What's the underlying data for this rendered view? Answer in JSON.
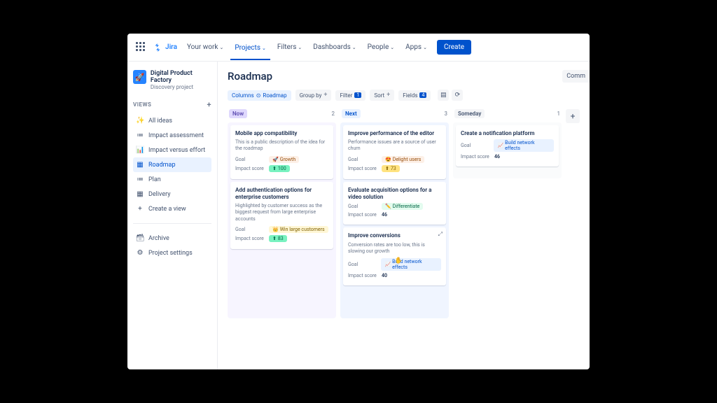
{
  "topbar": {
    "logo": "Jira",
    "nav": [
      "Your work",
      "Projects",
      "Filters",
      "Dashboards",
      "People",
      "Apps"
    ],
    "activeNav": 1,
    "create": "Create"
  },
  "sidebar": {
    "project": {
      "name": "Digital Product Factory",
      "subtitle": "Discovery project",
      "emoji": "🚀"
    },
    "viewsLabel": "VIEWS",
    "views": [
      {
        "icon": "✨",
        "label": "All ideas"
      },
      {
        "icon": "≔",
        "label": "Impact assessment"
      },
      {
        "icon": "📊",
        "label": "Impact versus effort"
      },
      {
        "icon": "▦",
        "label": "Roadmap"
      },
      {
        "icon": "≔",
        "label": "Plan"
      },
      {
        "icon": "▦",
        "label": "Delivery"
      }
    ],
    "createView": "Create a view",
    "archive": "Archive",
    "settings": "Project settings"
  },
  "main": {
    "title": "Roadmap",
    "commentBtn": "Comm",
    "filters": {
      "columns": {
        "label": "Columns",
        "value": "Roadmap"
      },
      "groupBy": "Group by",
      "filter": {
        "label": "Filter",
        "count": "1"
      },
      "sort": "Sort",
      "fields": {
        "label": "Fields",
        "count": "4"
      }
    }
  },
  "board": {
    "columns": [
      {
        "title": "Now",
        "count": "2",
        "styleClass": "col-now",
        "bodyClass": "",
        "cards": [
          {
            "title": "Mobile app compatibility",
            "desc": "This is a public description of the idea for the roadmap",
            "goal": {
              "label": "Growth",
              "icon": "🚀",
              "cls": "goal-growth"
            },
            "score": {
              "val": "100",
              "cls": ""
            },
            "showScoreTag": true
          },
          {
            "title": "Add authentication options for enterprise customers",
            "desc": "Highlighted by customer success as the biggest request from large enterprise accounts",
            "goal": {
              "label": "Win large customers",
              "icon": "👑",
              "cls": "goal-win"
            },
            "score": {
              "val": "83",
              "cls": ""
            },
            "showScoreTag": true
          }
        ]
      },
      {
        "title": "Next",
        "count": "3",
        "styleClass": "col-next",
        "bodyClass": "next",
        "cards": [
          {
            "title": "Improve performance of the editor",
            "desc": "Performance issues are a source of user churn",
            "goal": {
              "label": "Delight users",
              "icon": "😍",
              "cls": "goal-delight"
            },
            "score": {
              "val": "73",
              "cls": "med"
            },
            "showScoreTag": true
          },
          {
            "title": "Evaluate acquisition options for a video solution",
            "desc": "",
            "goal": {
              "label": "Differentiate",
              "icon": "✏️",
              "cls": "goal-diff"
            },
            "scorePlain": "46"
          },
          {
            "title": "Improve conversions",
            "desc": "Conversion rates are too low, this is slowing our growth",
            "goal": {
              "label": "Build network effects",
              "icon": "📈",
              "cls": "goal-network"
            },
            "scorePlain": "40",
            "expand": true,
            "cursor": true
          }
        ]
      },
      {
        "title": "Someday",
        "count": "1",
        "styleClass": "col-some",
        "bodyClass": "some",
        "cards": [
          {
            "title": "Create a notification platform",
            "desc": "",
            "goal": {
              "label": "Build network effects",
              "icon": "📈",
              "cls": "goal-network"
            },
            "scorePlain": "46"
          }
        ]
      }
    ]
  },
  "labels": {
    "goal": "Goal",
    "impactScore": "Impact score"
  }
}
